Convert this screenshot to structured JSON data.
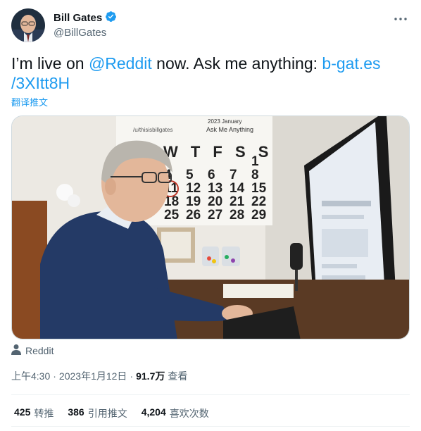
{
  "author": {
    "display_name": "Bill Gates",
    "handle": "@BillGates",
    "verified": true
  },
  "tweet": {
    "text_before": "I’m live on ",
    "mention": "@Reddit",
    "text_middle": " now. Ask me anything: ",
    "link": "b-gat.es /3XItt8H",
    "translate_label": "翻译推文"
  },
  "media": {
    "calendar_header": "/u/thisisbillgates",
    "calendar_year_month": "2023 January",
    "calendar_caption": "Ask Me Anything",
    "calendar_days": "W T F S S",
    "calendar_rows": [
      [
        "",
        "",
        "",
        "",
        "1"
      ],
      [
        "4",
        "5",
        "6",
        "7",
        "8"
      ],
      [
        "11",
        "12",
        "13",
        "14",
        "15"
      ],
      [
        "18",
        "19",
        "20",
        "21",
        "22"
      ],
      [
        "25",
        "26",
        "27",
        "28",
        "29"
      ]
    ]
  },
  "source": {
    "icon": "person-icon",
    "label": "Reddit"
  },
  "meta": {
    "time": "上午4:30",
    "separator": "·",
    "date": "2023年1月12日",
    "views_count": "91.7万",
    "views_label": "查看"
  },
  "stats": {
    "retweets_count": "425",
    "retweets_label": "转推",
    "quotes_count": "386",
    "quotes_label": "引用推文",
    "likes_count": "4,204",
    "likes_label": "喜欢次数"
  },
  "colors": {
    "accent": "#1d9bf0",
    "text": "#0f1419",
    "muted": "#536471"
  }
}
